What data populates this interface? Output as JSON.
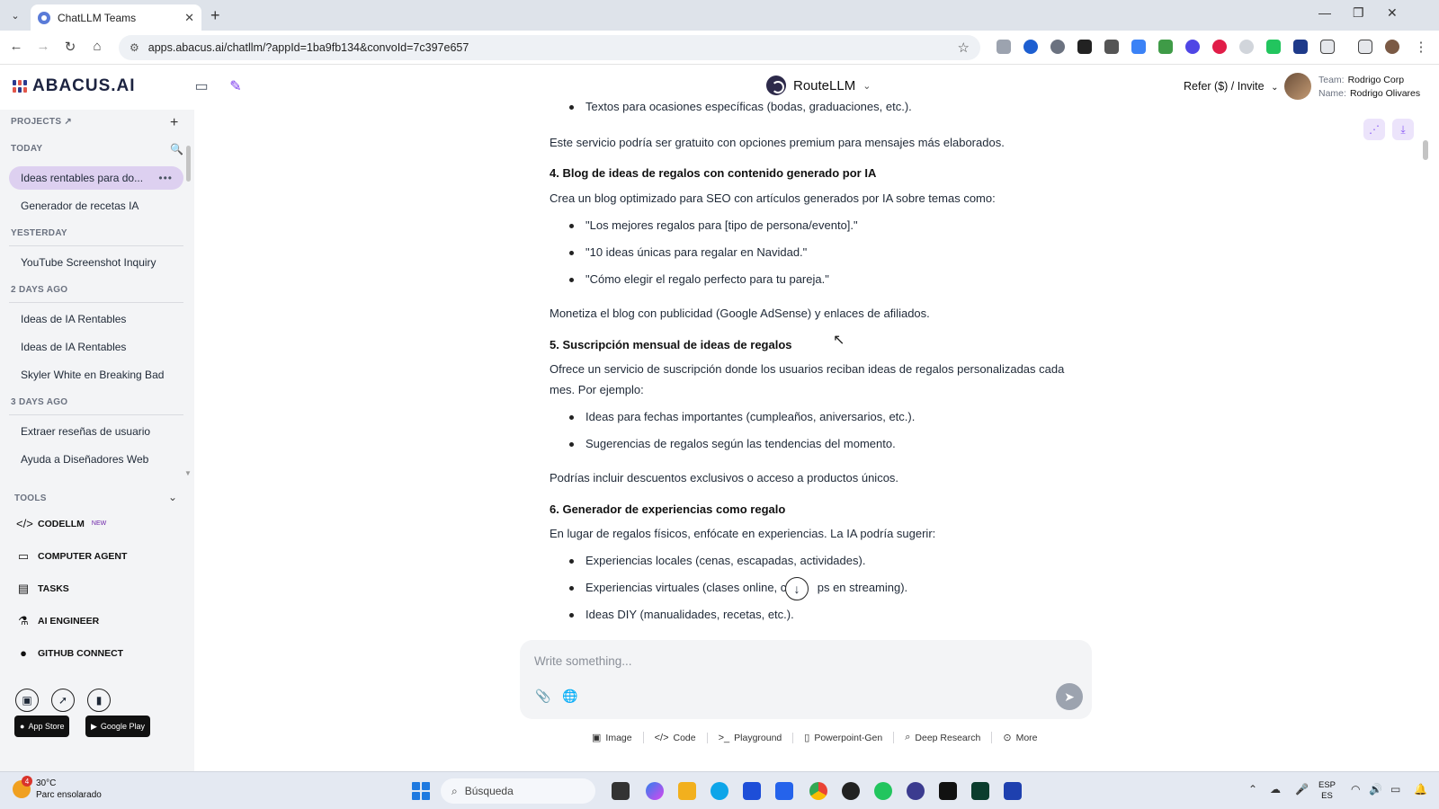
{
  "browser": {
    "tab_title": "ChatLLM Teams",
    "url": "apps.abacus.ai/chatllm/?appId=1ba9fb134&convoId=7c397e657"
  },
  "header": {
    "logo_text": "ABACUS.AI",
    "model_name": "RouteLLM",
    "refer_label": "Refer ($) / Invite",
    "team_key": "Team:",
    "team_value": "Rodrigo Corp",
    "name_key": "Name:",
    "name_value": "Rodrigo Olivares"
  },
  "sidebar": {
    "projects_label": "PROJECTS",
    "groups": [
      {
        "label": "TODAY",
        "items": [
          "Ideas rentables para do...",
          "Generador de recetas IA"
        ]
      },
      {
        "label": "YESTERDAY",
        "items": [
          "YouTube Screenshot Inquiry"
        ]
      },
      {
        "label": "2 DAYS AGO",
        "items": [
          "Ideas de IA Rentables",
          "Ideas de IA Rentables",
          "Skyler White en Breaking Bad"
        ]
      },
      {
        "label": "3 DAYS AGO",
        "items": [
          "Extraer reseñas de usuario",
          "Ayuda a Diseñadores Web"
        ]
      }
    ],
    "tools_label": "TOOLS",
    "tools": [
      "CODELLM",
      "COMPUTER AGENT",
      "TASKS",
      "AI ENGINEER",
      "GITHUB CONNECT"
    ],
    "codellm_badge": "NEW",
    "app_store": "App Store",
    "google_play": "Google Play"
  },
  "chat": {
    "partial_top": "Textos para ocasiones específicas (bodas, graduaciones, etc.).",
    "p1": "Este servicio podría ser gratuito con opciones premium para mensajes más elaborados.",
    "h4_num": "4.",
    "h4": "Blog de ideas de regalos con contenido generado por IA",
    "p4": "Crea un blog optimizado para SEO con artículos generados por IA sobre temas como:",
    "b4": [
      "\"Los mejores regalos para [tipo de persona/evento].\"",
      "\"10 ideas únicas para regalar en Navidad.\"",
      "\"Cómo elegir el regalo perfecto para tu pareja.\""
    ],
    "p4b": "Monetiza el blog con publicidad (Google AdSense) y enlaces de afiliados.",
    "h5_num": "5.",
    "h5": "Suscripción mensual de ideas de regalos",
    "p5": "Ofrece un servicio de suscripción donde los usuarios reciban ideas de regalos personalizadas cada mes. Por ejemplo:",
    "b5": [
      "Ideas para fechas importantes (cumpleaños, aniversarios, etc.).",
      "Sugerencias de regalos según las tendencias del momento."
    ],
    "p5b": "Podrías incluir descuentos exclusivos o acceso a productos únicos.",
    "h6_num": "6.",
    "h6": "Generador de experiencias como regalo",
    "p6": "En lugar de regalos físicos, enfócate en experiencias. La IA podría sugerir:",
    "b6": [
      "Experiencias locales (cenas, escapadas, actividades).",
      "Experiencias virtuales (clases online, con",
      "ps en streaming).",
      "Ideas DIY (manualidades, recetas, etc.)."
    ]
  },
  "composer": {
    "placeholder": "Write something...",
    "quick": [
      "Image",
      "Code",
      "Playground",
      "Powerpoint-Gen",
      "Deep Research",
      "More"
    ]
  },
  "taskbar": {
    "temp": "30°C",
    "weather": "Parc ensolarado",
    "badge": "4",
    "search": "Búsqueda",
    "lang1": "ESP",
    "lang2": "ES"
  }
}
